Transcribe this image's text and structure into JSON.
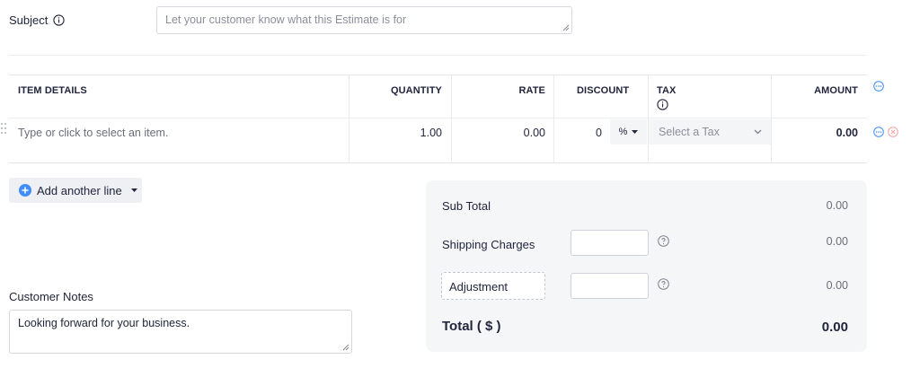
{
  "subject": {
    "label": "Subject",
    "placeholder": "Let your customer know what this Estimate is for"
  },
  "table": {
    "headers": {
      "item_details": "ITEM DETAILS",
      "quantity": "QUANTITY",
      "rate": "RATE",
      "discount": "DISCOUNT",
      "tax": "TAX",
      "amount": "AMOUNT"
    },
    "row": {
      "item_placeholder": "Type or click to select an item.",
      "quantity": "1.00",
      "rate": "0.00",
      "discount": "0",
      "discount_unit": "%",
      "tax_placeholder": "Select a Tax",
      "amount": "0.00"
    }
  },
  "add_line": {
    "label": "Add another line"
  },
  "customer_notes": {
    "label": "Customer Notes",
    "value": "Looking forward for your business."
  },
  "summary": {
    "sub_total_label": "Sub Total",
    "sub_total_value": "0.00",
    "shipping_label": "Shipping Charges",
    "shipping_value": "0.00",
    "adjustment_label": "Adjustment",
    "adjustment_value": "0.00",
    "total_label": "Total ( $ )",
    "total_value": "0.00"
  },
  "colors": {
    "accent": "#408dfb",
    "remove": "#f6a2a2"
  },
  "icons": [
    "info-icon",
    "more-options-icon",
    "remove-icon",
    "plus-circle-icon",
    "caret-down-icon",
    "help-icon",
    "drag-handle-icon",
    "chevron-down-icon"
  ]
}
